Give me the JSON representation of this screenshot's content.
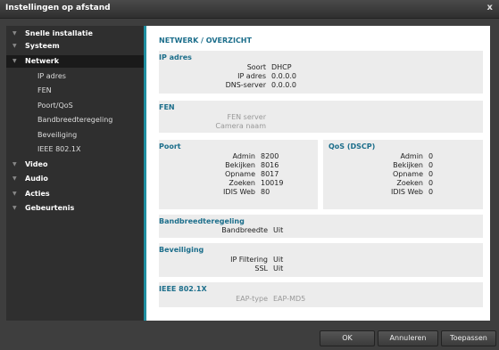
{
  "window": {
    "title": "Instellingen op afstand",
    "close_label": "x"
  },
  "sidebar": {
    "items": [
      {
        "label": "Snelle installatie",
        "level": 0
      },
      {
        "label": "Systeem",
        "level": 0
      },
      {
        "label": "Netwerk",
        "level": 0,
        "selected": true
      },
      {
        "label": "IP adres",
        "level": 1
      },
      {
        "label": "FEN",
        "level": 1
      },
      {
        "label": "Poort/QoS",
        "level": 1
      },
      {
        "label": "Bandbreedteregeling",
        "level": 1
      },
      {
        "label": "Beveiliging",
        "level": 1
      },
      {
        "label": "IEEE 802.1X",
        "level": 1
      },
      {
        "label": "Video",
        "level": 0
      },
      {
        "label": "Audio",
        "level": 0
      },
      {
        "label": "Acties",
        "level": 0
      },
      {
        "label": "Gebeurtenis",
        "level": 0
      }
    ]
  },
  "main": {
    "title": "NETWERK / OVERZICHT",
    "ip": {
      "heading": "IP adres",
      "rows": [
        {
          "key": "Soort",
          "value": "DHCP"
        },
        {
          "key": "IP adres",
          "value": "0.0.0.0"
        },
        {
          "key": "DNS-server",
          "value": "0.0.0.0"
        }
      ]
    },
    "fen": {
      "heading": "FEN",
      "rows": [
        {
          "key": "FEN server",
          "value": ""
        },
        {
          "key": "Camera naam",
          "value": ""
        }
      ]
    },
    "poort": {
      "heading": "Poort",
      "rows": [
        {
          "key": "Admin",
          "value": "8200"
        },
        {
          "key": "Bekijken",
          "value": "8016"
        },
        {
          "key": "Opname",
          "value": "8017"
        },
        {
          "key": "Zoeken",
          "value": "10019"
        },
        {
          "key": "IDIS Web",
          "value": "80"
        }
      ]
    },
    "qos": {
      "heading": "QoS (DSCP)",
      "rows": [
        {
          "key": "Admin",
          "value": "0"
        },
        {
          "key": "Bekijken",
          "value": "0"
        },
        {
          "key": "Opname",
          "value": "0"
        },
        {
          "key": "Zoeken",
          "value": "0"
        },
        {
          "key": "IDIS Web",
          "value": "0"
        }
      ]
    },
    "bandbreedte": {
      "heading": "Bandbreedteregeling",
      "rows": [
        {
          "key": "Bandbreedte",
          "value": "Uit"
        }
      ]
    },
    "beveiliging": {
      "heading": "Beveiliging",
      "rows": [
        {
          "key": "IP Filtering",
          "value": "Uit"
        },
        {
          "key": "SSL",
          "value": "Uit"
        }
      ]
    },
    "ieee": {
      "heading": "IEEE 802.1X",
      "rows": [
        {
          "key": "EAP-type",
          "value": "EAP-MD5"
        }
      ]
    }
  },
  "buttons": {
    "ok": "OK",
    "cancel": "Annuleren",
    "apply": "Toepassen"
  },
  "colors": {
    "accent": "#1f8ea0",
    "heading": "#1c6e8b",
    "section_bg": "#ececec",
    "chrome": "#3e3e3e"
  }
}
